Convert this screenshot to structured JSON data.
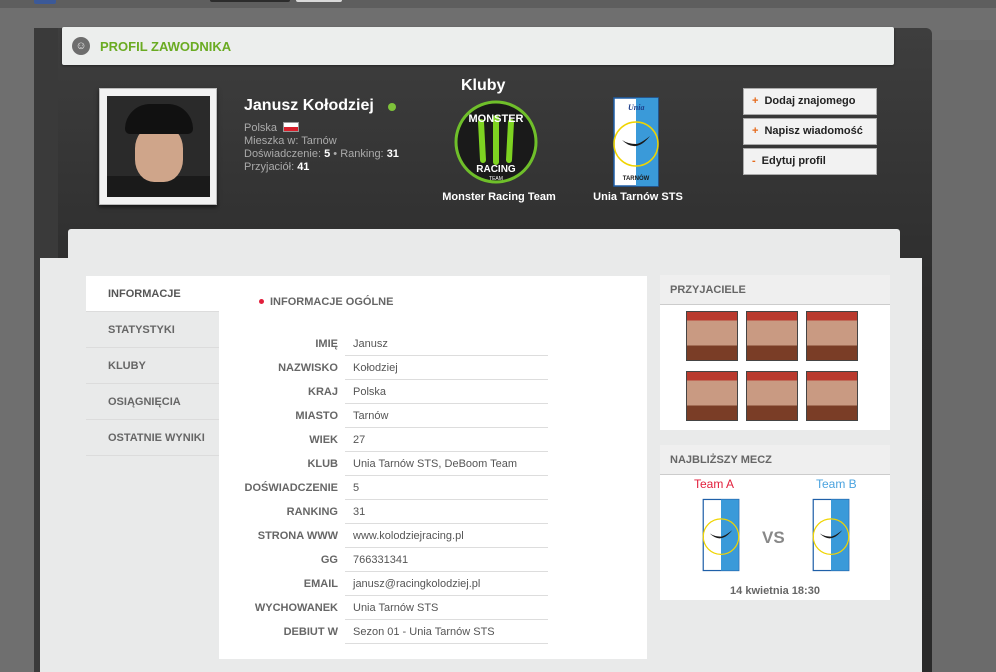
{
  "header": {
    "title": "PROFIL ZAWODNIKA"
  },
  "profile": {
    "name": "Janusz Kołodziej",
    "country": "Polska",
    "lives_label": "Mieszka w:",
    "lives_value": "Tarnów",
    "experience_label": "Doświadczenie:",
    "experience_value": "5",
    "ranking_label": "Ranking:",
    "ranking_value": "31",
    "friends_label": "Przyjaciół:",
    "friends_value": "41"
  },
  "clubs": {
    "title": "Kluby",
    "items": [
      {
        "name": "Monster Racing Team"
      },
      {
        "name": "Unia Tarnów STS"
      }
    ]
  },
  "actions": [
    {
      "sign": "+",
      "label": "Dodaj znajomego"
    },
    {
      "sign": "+",
      "label": "Napisz wiadomość"
    },
    {
      "sign": "-",
      "label": "Edytuj profil"
    }
  ],
  "tabs": [
    "INFORMACJE",
    "STATYSTYKI",
    "KLUBY",
    "OSIĄGNIĘCIA",
    "OSTATNIE WYNIKI"
  ],
  "info": {
    "section_title": "INFORMACJE OGÓLNE",
    "rows": [
      {
        "k": "IMIĘ",
        "v": "Janusz"
      },
      {
        "k": "NAZWISKO",
        "v": "Kołodziej"
      },
      {
        "k": "KRAJ",
        "v": "Polska"
      },
      {
        "k": "MIASTO",
        "v": "Tarnów"
      },
      {
        "k": "WIEK",
        "v": "27"
      },
      {
        "k": "KLUB",
        "v": "Unia Tarnów STS, DeBoom  Team"
      },
      {
        "k": "DOŚWIADCZENIE",
        "v": "5"
      },
      {
        "k": "RANKING",
        "v": "31"
      },
      {
        "k": "STRONA WWW",
        "v": "www.kolodziejracing.pl"
      },
      {
        "k": "GG",
        "v": "766331341"
      },
      {
        "k": "EMAIL",
        "v": "janusz@racingkolodziej.pl"
      },
      {
        "k": "WYCHOWANEK",
        "v": "Unia Tarnów STS"
      },
      {
        "k": "DEBIUT W",
        "v": "Sezon 01 - Unia Tarnów STS"
      }
    ]
  },
  "friends_box": {
    "title": "PRZYJACIELE",
    "count": 6
  },
  "match_box": {
    "title": "NAJBLIŻSZY MECZ",
    "team_a": "Team A",
    "team_b": "Team B",
    "vs": "VS",
    "date": "14 kwietnia 18:30"
  },
  "colors": {
    "accent_green": "#6aab22",
    "online": "#7ec23a",
    "action_sign": "#e56a1b",
    "team_a": "#e21e3b",
    "team_b": "#4aa3df"
  }
}
